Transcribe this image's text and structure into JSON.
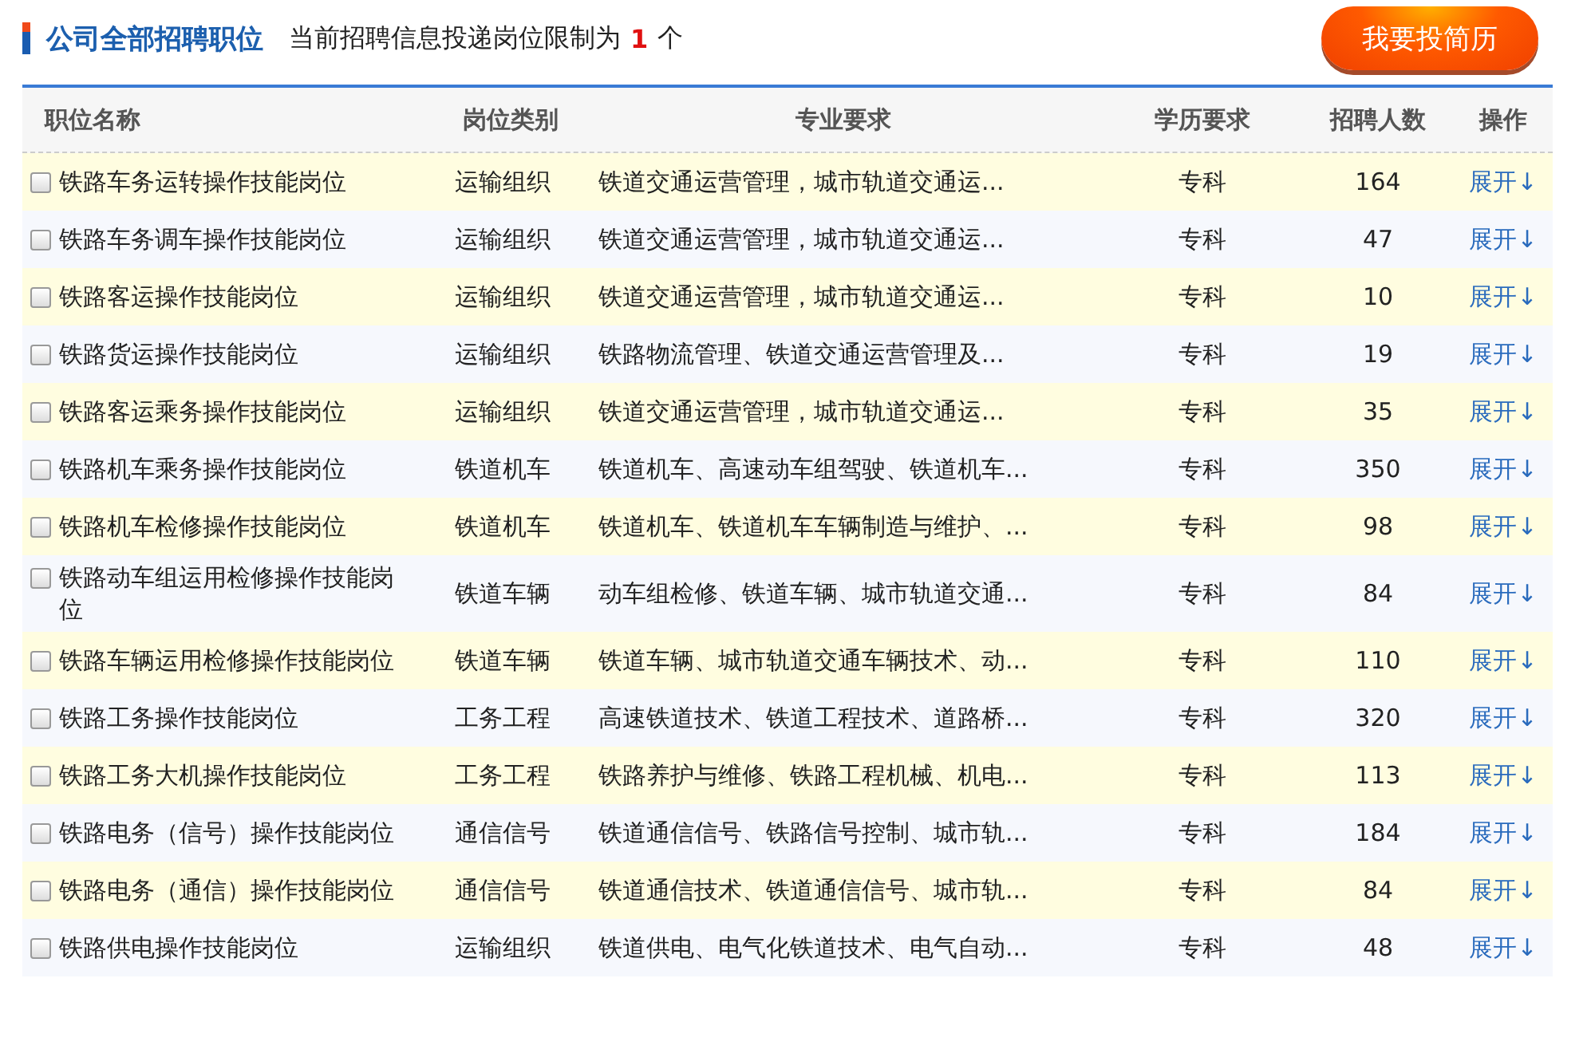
{
  "header": {
    "title": "公司全部招聘职位",
    "notice_prefix": "当前招聘信息投递岗位限制为",
    "notice_limit": "1",
    "notice_suffix": "个",
    "apply_button": "我要投简历"
  },
  "table": {
    "columns": [
      "职位名称",
      "岗位类别",
      "专业要求",
      "学历要求",
      "招聘人数",
      "操作"
    ],
    "rows": [
      {
        "checked": false,
        "name": "铁路车务运转操作技能岗位",
        "category": "运输组织",
        "major": "铁道交通运营管理，城市轨道交通运...",
        "education": "专科",
        "count": "164",
        "action": "展开↓"
      },
      {
        "checked": false,
        "name": "铁路车务调车操作技能岗位",
        "category": "运输组织",
        "major": "铁道交通运营管理，城市轨道交通运...",
        "education": "专科",
        "count": "47",
        "action": "展开↓"
      },
      {
        "checked": false,
        "name": "铁路客运操作技能岗位",
        "category": "运输组织",
        "major": "铁道交通运营管理，城市轨道交通运...",
        "education": "专科",
        "count": "10",
        "action": "展开↓"
      },
      {
        "checked": false,
        "name": "铁路货运操作技能岗位",
        "category": "运输组织",
        "major": "铁路物流管理、铁道交通运营管理及...",
        "education": "专科",
        "count": "19",
        "action": "展开↓"
      },
      {
        "checked": false,
        "name": "铁路客运乘务操作技能岗位",
        "category": "运输组织",
        "major": "铁道交通运营管理，城市轨道交通运...",
        "education": "专科",
        "count": "35",
        "action": "展开↓"
      },
      {
        "checked": false,
        "name": "铁路机车乘务操作技能岗位",
        "category": "铁道机车",
        "major": "铁道机车、高速动车组驾驶、铁道机车...",
        "education": "专科",
        "count": "350",
        "action": "展开↓"
      },
      {
        "checked": false,
        "name": "铁路机车检修操作技能岗位",
        "category": "铁道机车",
        "major": "铁道机车、铁道机车车辆制造与维护、...",
        "education": "专科",
        "count": "98",
        "action": "展开↓"
      },
      {
        "checked": false,
        "name": "铁路动车组运用检修操作技能岗位",
        "category": "铁道车辆",
        "major": "动车组检修、铁道车辆、城市轨道交通...",
        "education": "专科",
        "count": "84",
        "action": "展开↓"
      },
      {
        "checked": false,
        "name": "铁路车辆运用检修操作技能岗位",
        "category": "铁道车辆",
        "major": "铁道车辆、城市轨道交通车辆技术、动...",
        "education": "专科",
        "count": "110",
        "action": "展开↓"
      },
      {
        "checked": false,
        "name": "铁路工务操作技能岗位",
        "category": "工务工程",
        "major": "高速铁道技术、铁道工程技术、道路桥...",
        "education": "专科",
        "count": "320",
        "action": "展开↓"
      },
      {
        "checked": false,
        "name": "铁路工务大机操作技能岗位",
        "category": "工务工程",
        "major": "铁路养护与维修、铁路工程机械、机电...",
        "education": "专科",
        "count": "113",
        "action": "展开↓"
      },
      {
        "checked": false,
        "name": "铁路电务（信号）操作技能岗位",
        "category": "通信信号",
        "major": "铁道通信信号、铁路信号控制、城市轨...",
        "education": "专科",
        "count": "184",
        "action": "展开↓"
      },
      {
        "checked": false,
        "name": "铁路电务（通信）操作技能岗位",
        "category": "通信信号",
        "major": "铁道通信技术、铁道通信信号、城市轨...",
        "education": "专科",
        "count": "84",
        "action": "展开↓"
      },
      {
        "checked": false,
        "name": "铁路供电操作技能岗位",
        "category": "运输组织",
        "major": "铁道供电、电气化铁道技术、电气自动...",
        "education": "专科",
        "count": "48",
        "action": "展开↓"
      }
    ]
  }
}
